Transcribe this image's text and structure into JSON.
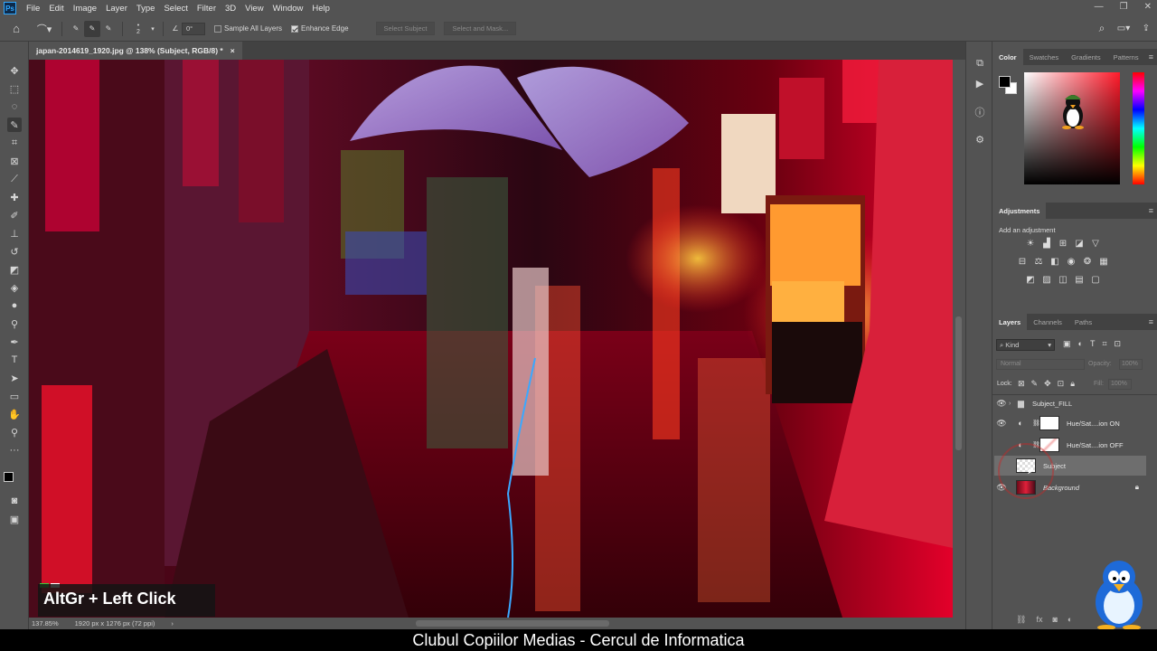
{
  "app": {
    "logo": "Ps",
    "menus": [
      "File",
      "Edit",
      "Image",
      "Layer",
      "Type",
      "Select",
      "Filter",
      "3D",
      "View",
      "Window",
      "Help"
    ],
    "window_controls": [
      "minimize-icon",
      "restore-icon",
      "close-icon"
    ]
  },
  "options": {
    "brush_size": "2",
    "angle": "0°",
    "sample_all_layers": "Sample All Layers",
    "sample_all_checked": false,
    "enhance_edge": "Enhance Edge",
    "enhance_edge_checked": true,
    "select_subject": "Select Subject",
    "select_and_mask": "Select and Mask..."
  },
  "document": {
    "tab_title": "japan-2014619_1920.jpg @ 138% (Subject, RGB/8) *",
    "close": "×"
  },
  "status": {
    "zoom": "137.85%",
    "info": "1920 px x 1276 px (72 ppi)",
    "arrow": "›"
  },
  "color_panel": {
    "tabs": [
      "Color",
      "Swatches",
      "Gradients",
      "Patterns"
    ],
    "active": "Color",
    "foreground": "#000000",
    "background": "#ffffff"
  },
  "adjustments": {
    "title": "Adjustments",
    "subtitle": "Add an adjustment"
  },
  "layers_panel": {
    "tabs": [
      "Layers",
      "Channels",
      "Paths"
    ],
    "active": "Layers",
    "filter_kind": "Kind",
    "blend_mode": "Normal",
    "opacity_label": "Opacity:",
    "opacity_value": "100%",
    "lock_label": "Lock:",
    "fill_label": "Fill:",
    "fill_value": "100%",
    "layers": [
      {
        "name": "Subject_FILL",
        "visible": true,
        "type": "group"
      },
      {
        "name": "Hue/Sat....ion ON",
        "visible": true,
        "type": "adjustment"
      },
      {
        "name": "Hue/Sat....ion OFF",
        "visible": false,
        "type": "adjustment"
      },
      {
        "name": "Subject",
        "visible": false,
        "type": "pixel",
        "selected": true
      },
      {
        "name": "Background",
        "visible": true,
        "type": "background",
        "locked": true
      }
    ]
  },
  "overlay": {
    "key_hint": "AltGr + Left Click",
    "caption": "Clubul Copiilor Medias - Cercul de Informatica"
  },
  "colors": {
    "accent": "#31a8ff",
    "canvas_red": "#e0002a",
    "panel_bg": "#535353"
  }
}
